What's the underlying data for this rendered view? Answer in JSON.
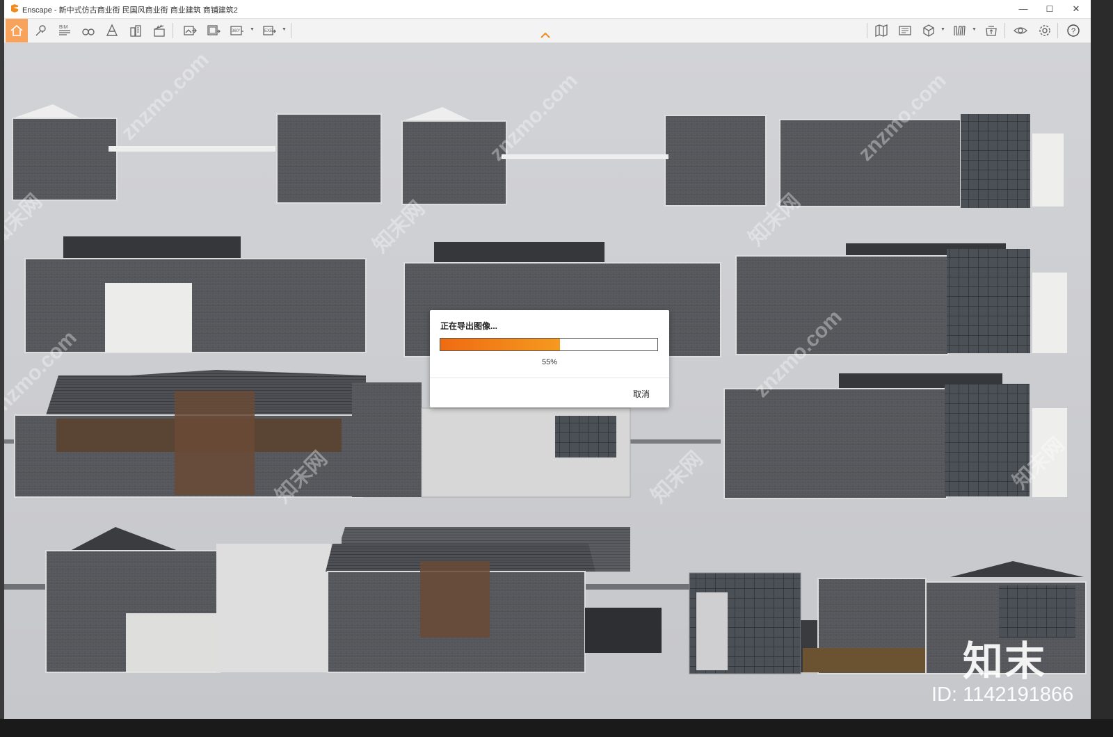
{
  "window": {
    "title": "Enscape - 新中式仿古商业街 民国风商业街 商业建筑 商铺建筑2",
    "minimize": "—",
    "maximize": "☐",
    "close": "✕"
  },
  "toolbar": {
    "left_tools": [
      "home-icon",
      "location-pin-icon",
      "bim-icon",
      "binoculars-icon",
      "cone-icon",
      "building-icon",
      "clapper-icon"
    ],
    "export_tools": [
      "export-image-icon",
      "export-batch-icon",
      "export-360-icon",
      "export-exe-icon"
    ],
    "right_tools": [
      "map-icon",
      "library-icon",
      "cube-icon",
      "books-icon",
      "cloud-upload-icon",
      "eye-icon",
      "settings-icon",
      "help-icon"
    ],
    "bim_label": "BIM",
    "pano_label": "360°",
    "exe_label": "EXE",
    "help_glyph": "?"
  },
  "dialog": {
    "title": "正在导出图像...",
    "progress": 0.55,
    "percent_label": "55%",
    "cancel_label": "取消"
  },
  "watermark": {
    "brand": "知末",
    "id_text": "ID: 1142191866",
    "site": "znzmo.com",
    "site_cn": "知末网"
  },
  "colors": {
    "accent": "#f7a35c",
    "progress_start": "#ef6b12",
    "progress_end": "#f59a1f",
    "viewport_bg": "#cbccd0"
  }
}
